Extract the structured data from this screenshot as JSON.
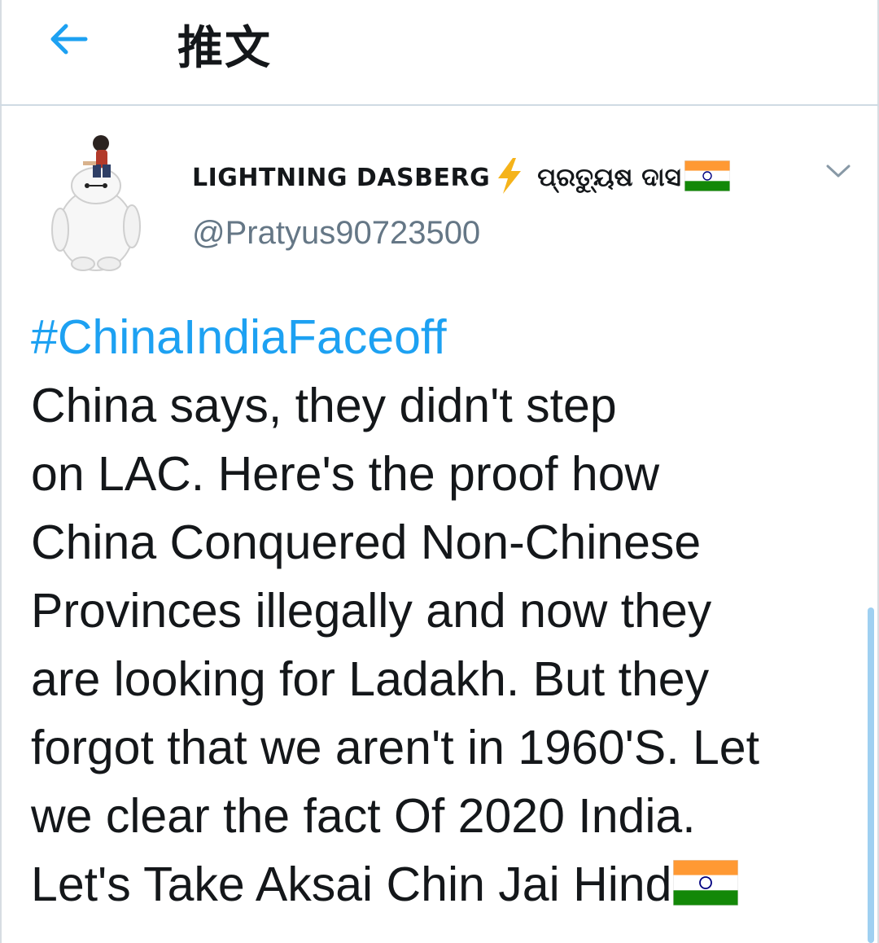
{
  "header": {
    "title": "推文",
    "back_icon": "arrow-left-icon"
  },
  "tweet": {
    "author": {
      "display_name": "LIGHTNING DASBERG",
      "display_name_native": "ପ୍ରତ୍ୟୁଷ ଦାସ",
      "handle": "@Pratyus90723500",
      "avatar_icon": "baymax-avatar-icon"
    },
    "menu_icon": "chevron-down-icon",
    "hashtag": "#ChinaIndiaFaceoff",
    "lines": [
      "China says, they didn't step",
      "on LAC. Here's the proof how",
      "China Conquered Non-Chinese",
      "Provinces illegally and now they",
      "are looking for Ladakh. But they",
      "forgot that we aren't in 1960'S. Let",
      "we clear the fact Of 2020 India.",
      "Let's Take Aksai Chin Jai Hind"
    ]
  },
  "colors": {
    "accent": "#1da1f2",
    "text": "#14171a",
    "secondary_text": "#657786",
    "divider": "#d0dbe3"
  }
}
